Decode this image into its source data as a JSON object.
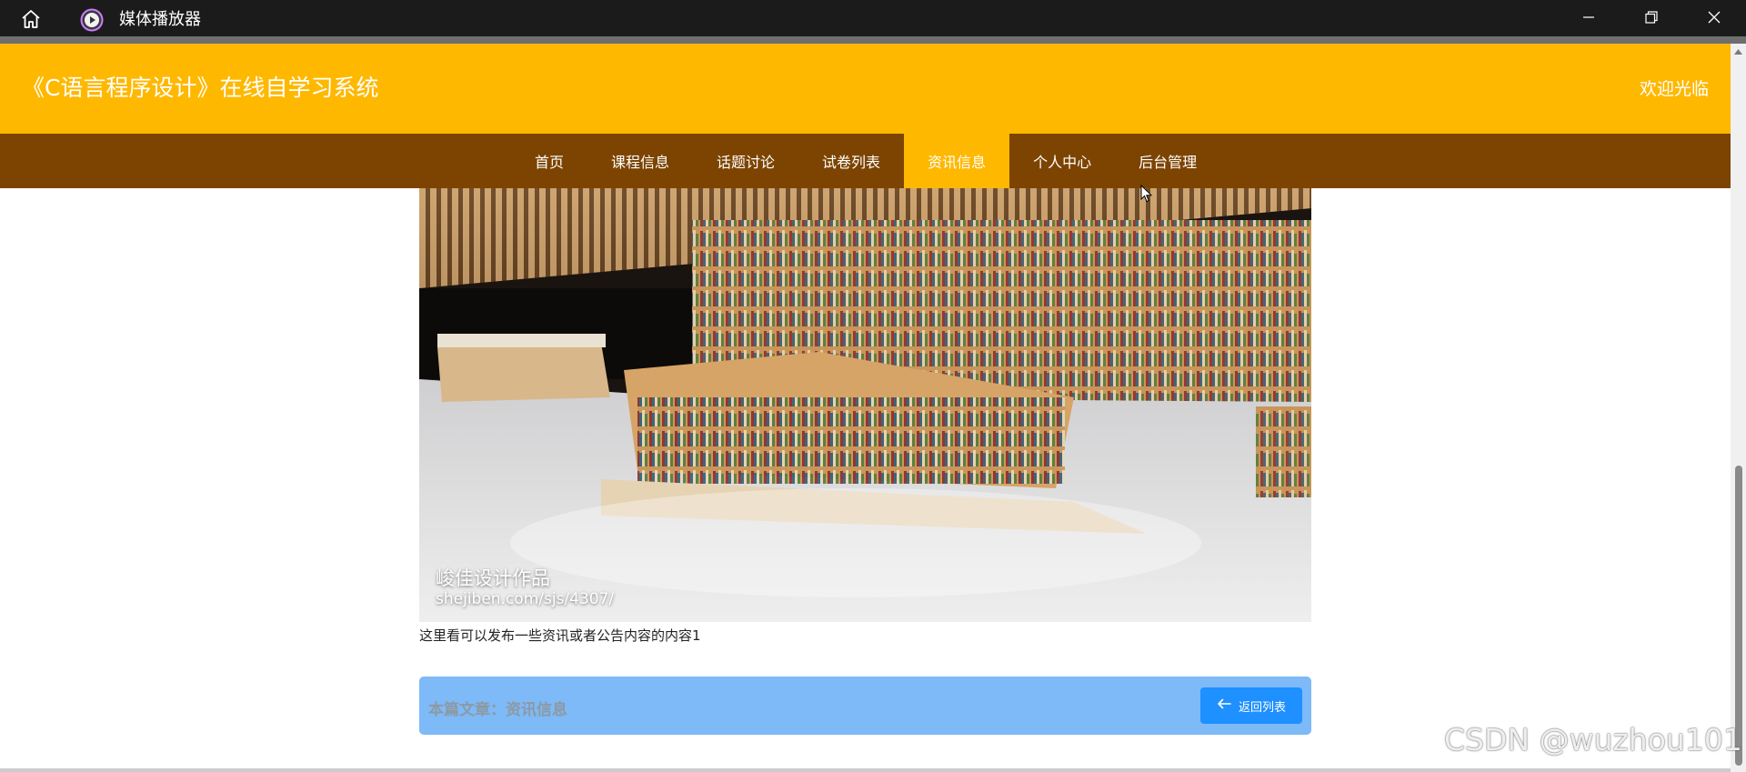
{
  "window": {
    "title": "媒体播放器",
    "icons": [
      "home-icon",
      "play-icon",
      "minimize-icon",
      "maximize-icon",
      "close-icon"
    ]
  },
  "header": {
    "title": "《C语言程序设计》在线自学习系统",
    "welcome": "欢迎光临"
  },
  "nav": {
    "items": [
      {
        "label": "首页"
      },
      {
        "label": "课程信息"
      },
      {
        "label": "话题讨论"
      },
      {
        "label": "试卷列表"
      },
      {
        "label": "资讯信息"
      },
      {
        "label": "个人中心"
      },
      {
        "label": "后台管理"
      }
    ],
    "active_index": 4
  },
  "content": {
    "image_caption_title": "峻佳设计作品",
    "image_caption_url": "shejiben.com/sjs/4307/",
    "description": "这里看可以发布一些资讯或者公告内容的内容1",
    "article_label": "本篇文章：资讯信息",
    "back_button": "返回列表"
  },
  "watermark": "CSDN @wuzhou101",
  "colors": {
    "header_bg": "#ffb800",
    "nav_bg": "#7c4400",
    "nav_active": "#ffb800",
    "article_bar": "#7dbaf7",
    "back_button": "#1e90ff",
    "titlebar": "#1b1b1b"
  }
}
